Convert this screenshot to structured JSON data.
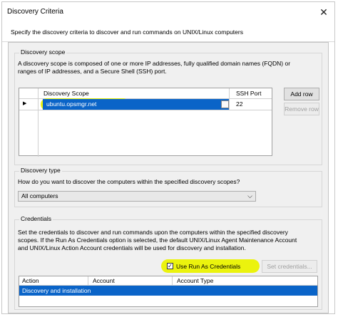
{
  "window": {
    "title": "Discovery Criteria",
    "close_glyph": "✕"
  },
  "instruction": "Specify the discovery criteria to discover and run commands on UNIX/Linux computers",
  "discovery_scope": {
    "legend": "Discovery scope",
    "description_line1": "A discovery scope is composed of one or more IP addresses, fully qualified domain names (FQDN) or",
    "description_line2": "ranges of IP addresses, and a Secure Shell (SSH) port.",
    "columns": [
      "Discovery Scope",
      "SSH Port"
    ],
    "rows": [
      {
        "indicator": "▶",
        "scope": "ubuntu.opsmgr.net",
        "ssh_port": "22",
        "edit_icon": "edit-icon"
      }
    ],
    "add_row_label": "Add row",
    "remove_row_label": "Remove row"
  },
  "discovery_type": {
    "legend": "Discovery type",
    "question": "How do you want to discover the computers within the specified discovery scopes?",
    "selected": "All computers"
  },
  "credentials": {
    "legend": "Credentials",
    "desc_line1": "Set the credentials to discover and run commands upon the computers within the specified discovery",
    "desc_line2": "scopes. If the Run As Credentials option is selected, the default UNIX/Linux Agent Maintenance Account",
    "desc_line3": "and UNIX/Linux Action Account credentials will be used for discovery and installation.",
    "use_run_as_label": "Use Run As Credentials",
    "use_run_as_checked": "✓",
    "set_credentials_label": "Set credentials...",
    "columns": [
      "Action",
      "Account",
      "Account Type"
    ],
    "rows": [
      {
        "action": "Discovery and installation",
        "account": "",
        "account_type": ""
      }
    ]
  },
  "colors": {
    "highlight": "#eaf200",
    "selection": "#0a64c8",
    "panel": "#f0f0f0"
  }
}
